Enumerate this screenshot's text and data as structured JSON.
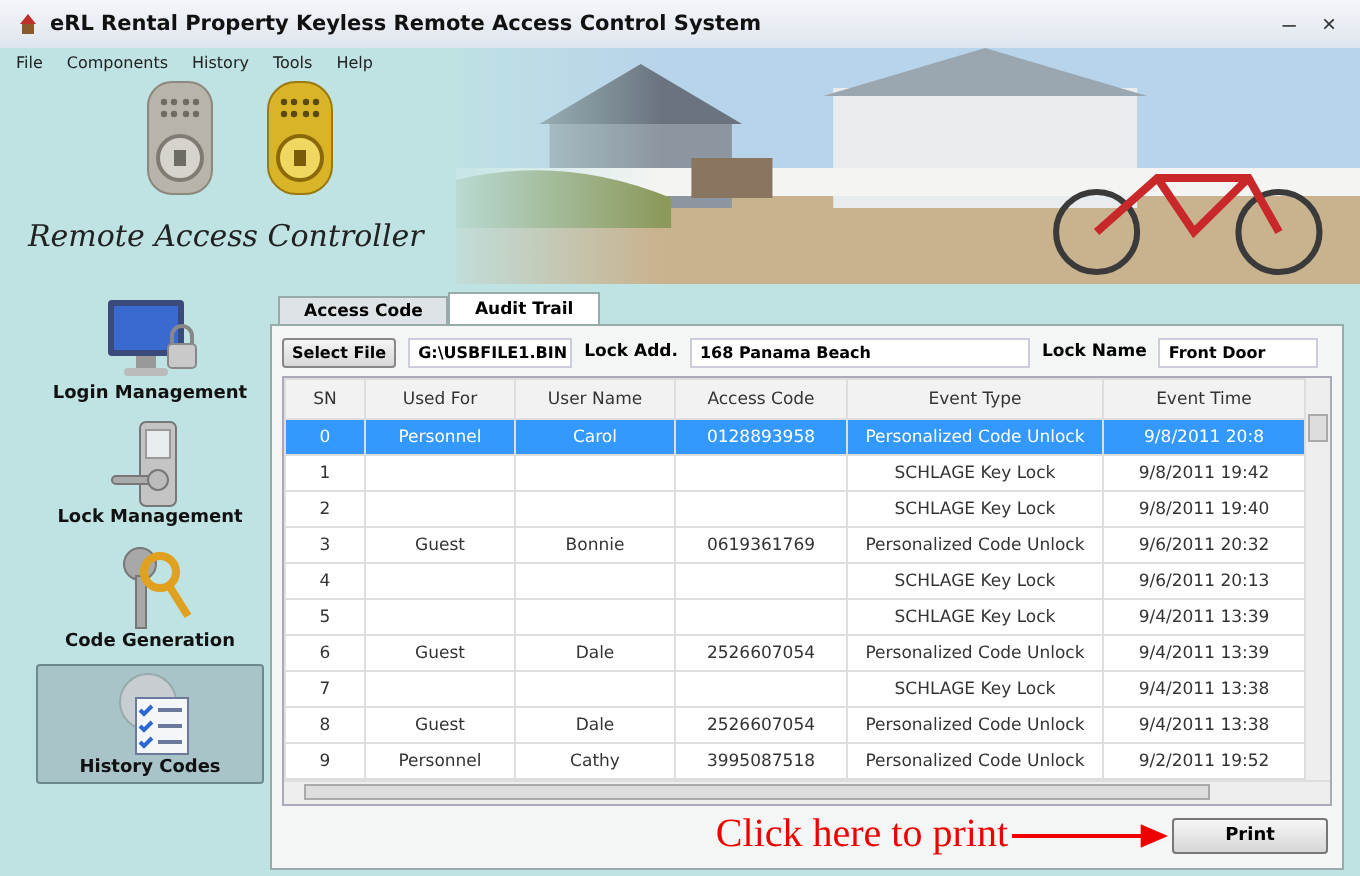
{
  "window": {
    "title": "eRL Rental Property Keyless Remote Access Control System",
    "controls": [
      "–",
      "×"
    ]
  },
  "menu": [
    "File",
    "Components",
    "History",
    "Tools",
    "Help"
  ],
  "banner": {
    "caption": "Remote Access Controller"
  },
  "sidebar": {
    "items": [
      {
        "label": "Login Management",
        "kind": "monitor",
        "selected": false
      },
      {
        "label": "Lock Management",
        "kind": "lock",
        "selected": false
      },
      {
        "label": "Code Generation",
        "kind": "keys",
        "selected": false
      },
      {
        "label": "History Codes",
        "kind": "checklist",
        "selected": true
      }
    ]
  },
  "tabs": [
    {
      "label": "Access Code",
      "selected": false
    },
    {
      "label": "Audit Trail",
      "selected": true
    }
  ],
  "file_bar": {
    "button": "Select File",
    "path": "G:\\USBFILE1.BIN",
    "lock_address_label": "Lock Add.",
    "lock_address": "168 Panama Beach",
    "lock_name_label": "Lock Name",
    "lock_name": "Front Door"
  },
  "table": {
    "columns": [
      "SN",
      "Used For",
      "User Name",
      "Access Code",
      "Event Type",
      "Event Time"
    ],
    "rows": [
      {
        "cells": [
          "0",
          "Personnel",
          "Carol",
          "0128893958",
          "Personalized Code Unlock",
          "9/8/2011 20:8"
        ],
        "selected": true
      },
      {
        "cells": [
          "1",
          "",
          "",
          "",
          "SCHLAGE Key Lock",
          "9/8/2011 19:42"
        ],
        "selected": false
      },
      {
        "cells": [
          "2",
          "",
          "",
          "",
          "SCHLAGE Key Lock",
          "9/8/2011 19:40"
        ],
        "selected": false
      },
      {
        "cells": [
          "3",
          "Guest",
          "Bonnie",
          "0619361769",
          "Personalized Code Unlock",
          "9/6/2011 20:32"
        ],
        "selected": false
      },
      {
        "cells": [
          "4",
          "",
          "",
          "",
          "SCHLAGE Key Lock",
          "9/6/2011 20:13"
        ],
        "selected": false
      },
      {
        "cells": [
          "5",
          "",
          "",
          "",
          "SCHLAGE Key Lock",
          "9/4/2011 13:39"
        ],
        "selected": false
      },
      {
        "cells": [
          "6",
          "Guest",
          "Dale",
          "2526607054",
          "Personalized Code Unlock",
          "9/4/2011 13:39"
        ],
        "selected": false
      },
      {
        "cells": [
          "7",
          "",
          "",
          "",
          "SCHLAGE Key Lock",
          "9/4/2011 13:38"
        ],
        "selected": false
      },
      {
        "cells": [
          "8",
          "Guest",
          "Dale",
          "2526607054",
          "Personalized Code Unlock",
          "9/4/2011 13:38"
        ],
        "selected": false
      },
      {
        "cells": [
          "9",
          "Personnel",
          "Cathy",
          "3995087518",
          "Personalized Code Unlock",
          "9/2/2011 19:52"
        ],
        "selected": false
      }
    ]
  },
  "annotation": "Click here to print",
  "print_button": "Print"
}
